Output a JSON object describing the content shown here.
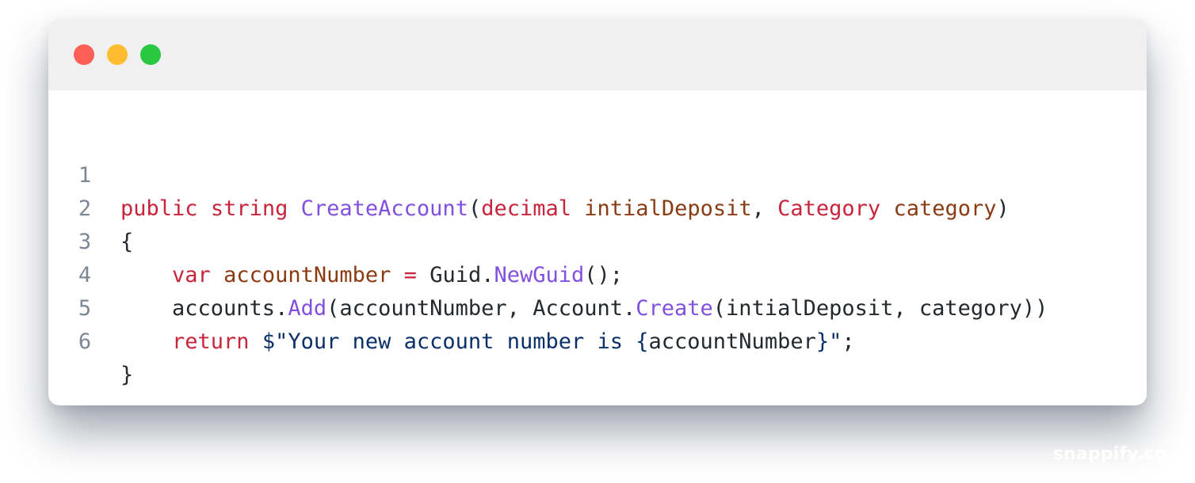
{
  "window": {
    "controls": [
      {
        "name": "close",
        "color": "#ff5f57"
      },
      {
        "name": "minimize",
        "color": "#febc2e"
      },
      {
        "name": "maximize",
        "color": "#28c840"
      }
    ]
  },
  "code": {
    "language": "C#",
    "lines": [
      {
        "number": "1",
        "tokens": [
          {
            "text": "public",
            "kind": "keyword"
          },
          {
            "text": " ",
            "kind": "text"
          },
          {
            "text": "string",
            "kind": "keyword"
          },
          {
            "text": " ",
            "kind": "text"
          },
          {
            "text": "CreateAccount",
            "kind": "function"
          },
          {
            "text": "(",
            "kind": "text"
          },
          {
            "text": "decimal",
            "kind": "keyword"
          },
          {
            "text": " ",
            "kind": "text"
          },
          {
            "text": "intialDeposit",
            "kind": "identifier"
          },
          {
            "text": ", ",
            "kind": "text"
          },
          {
            "text": "Category",
            "kind": "keyword"
          },
          {
            "text": " ",
            "kind": "text"
          },
          {
            "text": "category",
            "kind": "identifier"
          },
          {
            "text": ")",
            "kind": "text"
          }
        ]
      },
      {
        "number": "2",
        "tokens": [
          {
            "text": "{",
            "kind": "text"
          }
        ]
      },
      {
        "number": "3",
        "tokens": [
          {
            "text": "    ",
            "kind": "text"
          },
          {
            "text": "var",
            "kind": "keyword"
          },
          {
            "text": " ",
            "kind": "text"
          },
          {
            "text": "accountNumber",
            "kind": "identifier"
          },
          {
            "text": " ",
            "kind": "text"
          },
          {
            "text": "=",
            "kind": "keyword"
          },
          {
            "text": " Guid.",
            "kind": "text"
          },
          {
            "text": "NewGuid",
            "kind": "function"
          },
          {
            "text": "();",
            "kind": "text"
          }
        ]
      },
      {
        "number": "4",
        "tokens": [
          {
            "text": "    accounts.",
            "kind": "text"
          },
          {
            "text": "Add",
            "kind": "function"
          },
          {
            "text": "(accountNumber, Account.",
            "kind": "text"
          },
          {
            "text": "Create",
            "kind": "function"
          },
          {
            "text": "(intialDeposit, category))",
            "kind": "text"
          }
        ]
      },
      {
        "number": "5",
        "tokens": [
          {
            "text": "    ",
            "kind": "text"
          },
          {
            "text": "return",
            "kind": "keyword"
          },
          {
            "text": " ",
            "kind": "text"
          },
          {
            "text": "$\"Your new account number is {",
            "kind": "string"
          },
          {
            "text": "accountNumber",
            "kind": "text"
          },
          {
            "text": "}\"",
            "kind": "string"
          },
          {
            "text": ";",
            "kind": "text"
          }
        ]
      },
      {
        "number": "6",
        "tokens": [
          {
            "text": "}",
            "kind": "text"
          }
        ]
      }
    ]
  },
  "colors": {
    "keyword": "#c8243b",
    "function": "#8250df",
    "identifier": "#8a3b12",
    "text": "#24292e",
    "string": "#0b3069",
    "line_number": "#7b8794"
  },
  "watermark": "snappify.co"
}
